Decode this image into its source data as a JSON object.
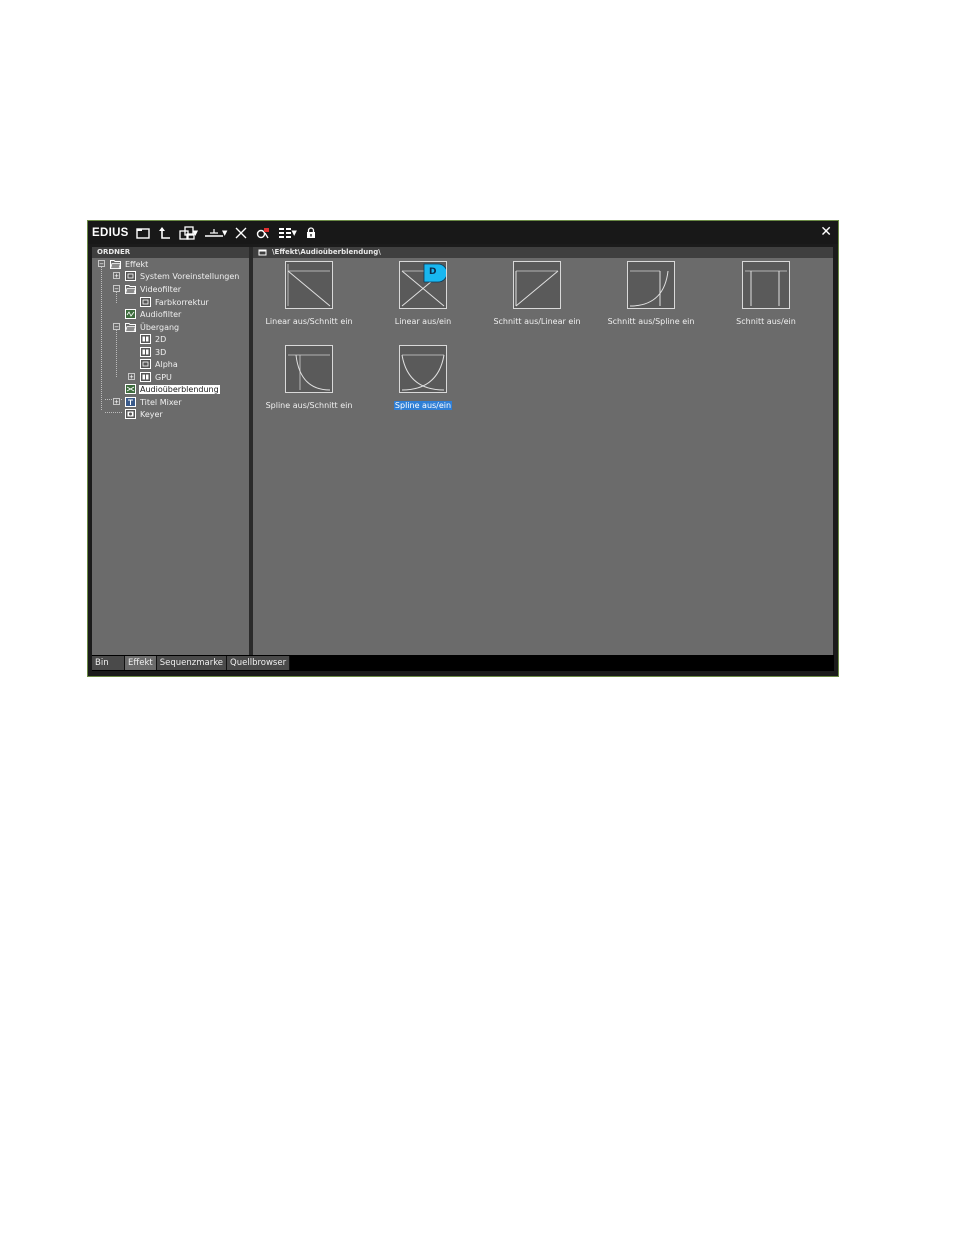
{
  "window": {
    "app_title": "EDIUS",
    "close_glyph": "✕"
  },
  "toolbar": {
    "icons": [
      "new-folder-icon",
      "up-folder-icon",
      "view-layout-icon",
      "align-icon",
      "delete-icon",
      "properties-icon",
      "view-mode-icon",
      "lock-icon"
    ]
  },
  "folder_pane": {
    "header": "ORDNER",
    "tree": [
      {
        "label": "Effekt",
        "icon": "open-folder-icon"
      },
      {
        "label": "System Voreinstellungen",
        "icon": "effect-folder-icon"
      },
      {
        "label": "Videofilter",
        "icon": "open-folder-icon"
      },
      {
        "label": "Farbkorrektur",
        "icon": "effect-folder-icon"
      },
      {
        "label": "Audiofilter",
        "icon": "audio-filter-icon"
      },
      {
        "label": "Übergang",
        "icon": "open-folder-icon"
      },
      {
        "label": "2D",
        "icon": "transition-icon"
      },
      {
        "label": "3D",
        "icon": "transition-icon"
      },
      {
        "label": "Alpha",
        "icon": "effect-folder-icon"
      },
      {
        "label": "GPU",
        "icon": "transition-icon"
      },
      {
        "label": "Audioüberblendung",
        "icon": "audio-crossfade-icon",
        "selected": true
      },
      {
        "label": "Titel Mixer",
        "icon": "title-mixer-icon"
      },
      {
        "label": "Keyer",
        "icon": "keyer-icon"
      }
    ]
  },
  "content_pane": {
    "path": "\\Effekt\\Audioüberblendung\\",
    "effects": [
      {
        "label": "Linear aus/Schnitt ein",
        "curve": "linear-cut"
      },
      {
        "label": "Linear aus/ein",
        "curve": "linear-linear",
        "default_badge": "D"
      },
      {
        "label": "Schnitt aus/Linear ein",
        "curve": "cut-linear"
      },
      {
        "label": "Schnitt aus/Spline ein",
        "curve": "cut-spline"
      },
      {
        "label": "Schnitt aus/ein",
        "curve": "cut-cut"
      },
      {
        "label": "Spline aus/Schnitt ein",
        "curve": "spline-cut"
      },
      {
        "label": "Spline aus/ein",
        "curve": "spline-spline",
        "selected": true
      }
    ]
  },
  "tabs": [
    {
      "label": "Bin",
      "active": false
    },
    {
      "label": "Effekt",
      "active": true
    },
    {
      "label": "Sequenzmarke",
      "active": false
    },
    {
      "label": "Quellbrowser",
      "active": false
    }
  ],
  "colors": {
    "badge": "#19b7f0",
    "selection": "#2f7fd6",
    "pane_bg": "#6b6b6b",
    "frame_green": "#6b8a45"
  }
}
